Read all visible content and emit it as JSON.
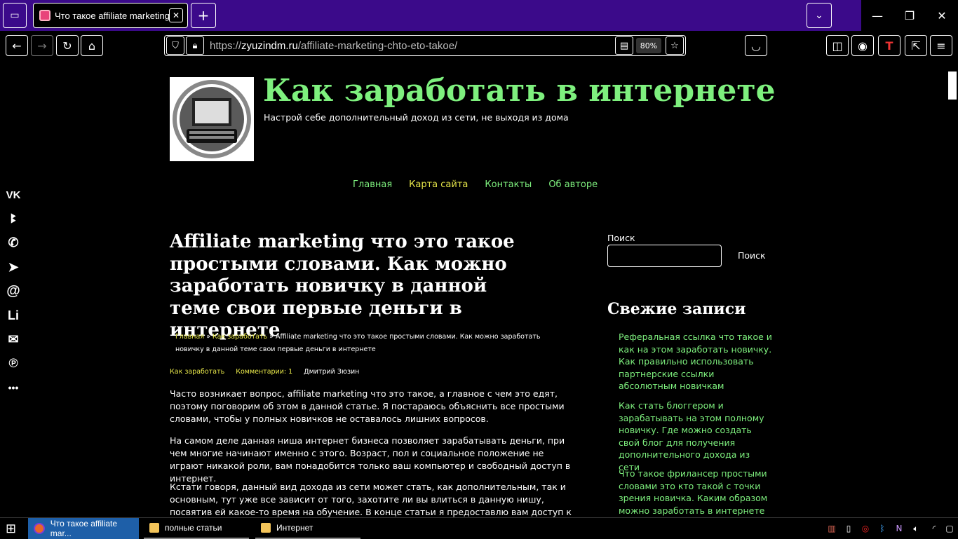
{
  "browser": {
    "tab_title": "Что такое affiliate marketing",
    "url_scheme": "https://",
    "url_host": "zyuzindm.ru",
    "url_path": "/affiliate-marketing-chto-eto-takoe/",
    "zoom": "80%"
  },
  "site": {
    "title": "Как заработать в интернете",
    "description": "Настрой себе дополнительный доход из сети, не выходя из дома",
    "nav": [
      "Главная",
      "Карта сайта",
      "Контакты",
      "Об авторе"
    ]
  },
  "social": [
    "VK",
    "ok",
    "wa",
    "tg",
    "@",
    "Li",
    "mail",
    "P",
    "•••"
  ],
  "post": {
    "title": "Affiliate marketing что это такое простыми словами. Как можно заработать новичку в данной теме свои первые деньги в интернете",
    "breadcrumb_home": "Главная",
    "breadcrumb_sep": " » ",
    "breadcrumb_cat": "Как заработать",
    "breadcrumb_current": "Affiliate marketing что это такое простыми словами. Как можно заработать новичку в данной теме свои первые деньги в интернете",
    "category": "Как заработать",
    "comments": "Комментарии: 1",
    "author": "Дмитрий Зюзин",
    "paragraphs": [
      "Часто возникает вопрос, affiliate marketing что это такое, а главное с чем это едят, поэтому поговорим об этом в данной статье. Я постараюсь объяснить все простыми словами, чтобы у полных новичков не оставалось лишних вопросов.",
      "На самом деле данная ниша интернет бизнеса позволяет зарабатывать деньги, при чем многие начинают именно с этого. Возраст, пол и социальное положение не играют никакой роли, вам понадобится только ваш компьютер и свободный доступ в интернет.",
      "Кстати говоря, данный вид дохода из сети может стать, как дополнительным, так и основным, тут уже все зависит от того, захотите ли вы влиться в данную нишу, посвятив ей какое-то время на обучение. В конце статьи я предоставлю вам доступ к онлайн-занятию,"
    ]
  },
  "sidebar": {
    "search_label": "Поиск",
    "search_button": "Поиск",
    "recent_title": "Свежие записи",
    "recent": [
      "Реферальная ссылка что такое и как на этом заработать новичку. Как правильно использовать партнерские ссылки абсолютным новичкам",
      "Как стать блоггером и зарабатывать на этом полному новичку. Где можно создать свой блог для получения дополнительного дохода из сети",
      "Что такое фрилансер простыми словами это кто такой с точки зрения новичка. Каким образом можно заработать в интернете на"
    ]
  },
  "taskbar": {
    "items": [
      "Что такое affiliate mar...",
      "полные статьи",
      "Интернет"
    ]
  }
}
